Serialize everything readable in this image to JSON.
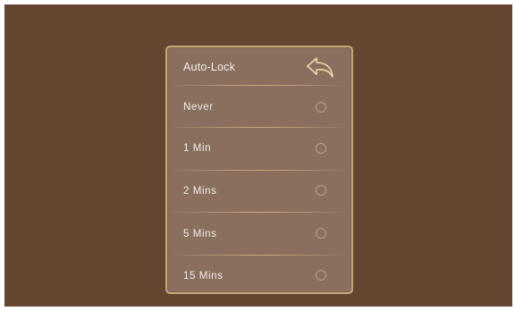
{
  "panel": {
    "title": "Auto-Lock",
    "back_icon": "back-arrow-icon",
    "options": [
      {
        "label": "Never",
        "selected": false
      },
      {
        "label": "1 Min",
        "selected": false
      },
      {
        "label": "2 Mins",
        "selected": false
      },
      {
        "label": "5 Mins",
        "selected": false
      },
      {
        "label": "15 Mins",
        "selected": false
      }
    ]
  },
  "colors": {
    "background": "#644631",
    "panel": "#8a6f5e",
    "panel_border": "#c6a772",
    "text": "#f1ece6",
    "back_icon": "#efd9a8"
  }
}
